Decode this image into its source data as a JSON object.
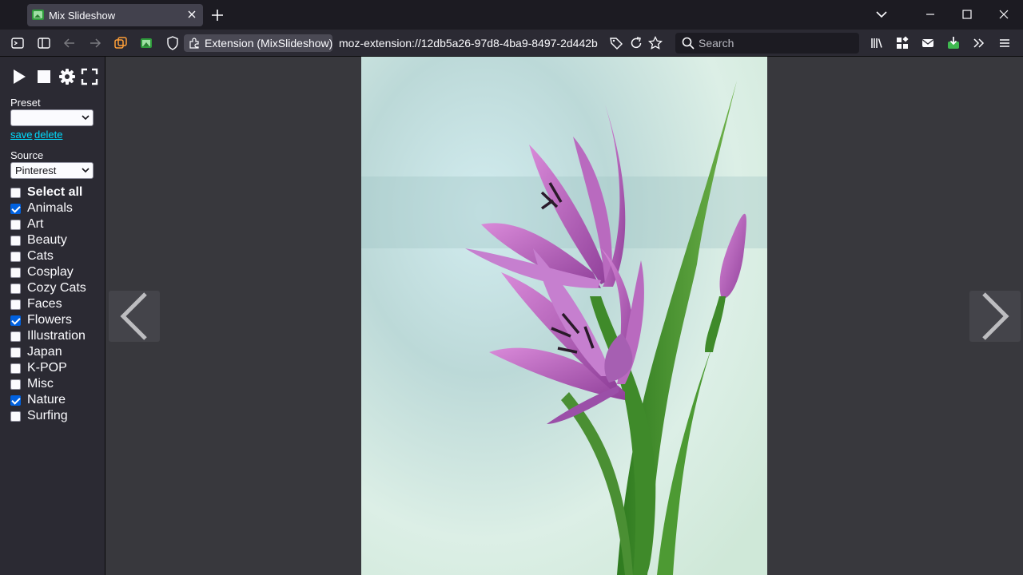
{
  "tab": {
    "title": "Mix Slideshow",
    "favicon": "slideshow-icon"
  },
  "toolbar": {
    "identity_label": "Extension (MixSlideshow)",
    "url": "moz-extension://12db5a26-97d8-4ba9-8497-2d442b",
    "search_placeholder": "Search"
  },
  "sidebar": {
    "preset_label": "Preset",
    "preset_value": "",
    "save_link": "save",
    "delete_link": "delete",
    "source_label": "Source",
    "source_value": "Pinterest",
    "categories": [
      {
        "label": "Select all",
        "checked": false
      },
      {
        "label": "Animals",
        "checked": true
      },
      {
        "label": "Art",
        "checked": false
      },
      {
        "label": "Beauty",
        "checked": false
      },
      {
        "label": "Cats",
        "checked": false
      },
      {
        "label": "Cosplay",
        "checked": false
      },
      {
        "label": "Cozy Cats",
        "checked": false
      },
      {
        "label": "Faces",
        "checked": false
      },
      {
        "label": "Flowers",
        "checked": true
      },
      {
        "label": "Illustration",
        "checked": false
      },
      {
        "label": "Japan",
        "checked": false
      },
      {
        "label": "K-POP",
        "checked": false
      },
      {
        "label": "Misc",
        "checked": false
      },
      {
        "label": "Nature",
        "checked": true
      },
      {
        "label": "Surfing",
        "checked": false
      }
    ]
  },
  "colors": {
    "checkbox_checked": "#0061e0",
    "link": "#00ddff",
    "sidebar_bg": "#2b2a33",
    "stage_bg": "#38383d"
  }
}
